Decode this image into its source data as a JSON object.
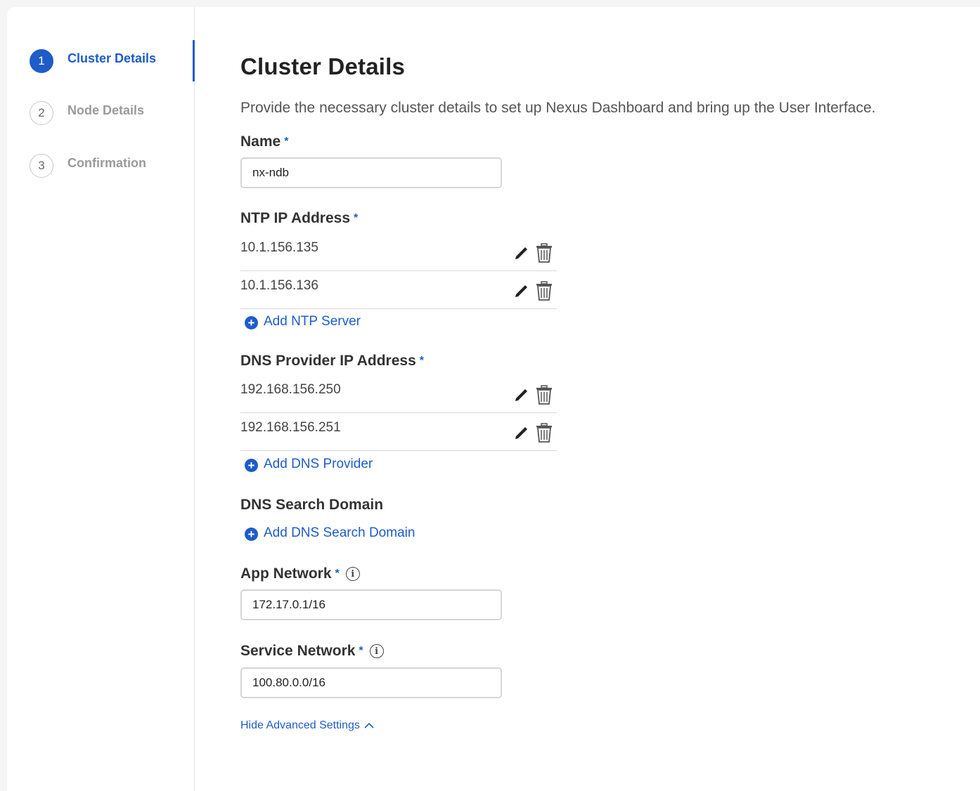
{
  "steps": [
    {
      "number": "1",
      "label": "Cluster Details",
      "active": true
    },
    {
      "number": "2",
      "label": "Node Details",
      "active": false
    },
    {
      "number": "3",
      "label": "Confirmation",
      "active": false
    }
  ],
  "main": {
    "title": "Cluster Details",
    "description": "Provide the necessary cluster details to set up Nexus Dashboard and bring up the User Interface.",
    "name": {
      "label": "Name",
      "required": "*",
      "value": "nx-ndb"
    },
    "ntp": {
      "label": "NTP IP Address",
      "required": "*",
      "items": [
        "10.1.156.135",
        "10.1.156.136"
      ],
      "add_label": "Add NTP Server"
    },
    "dns_provider": {
      "label": "DNS Provider IP Address",
      "required": "*",
      "items": [
        "192.168.156.250",
        "192.168.156.251"
      ],
      "add_label": "Add DNS Provider"
    },
    "dns_search": {
      "label": "DNS Search Domain",
      "add_label": "Add DNS Search Domain"
    },
    "app_network": {
      "label": "App Network",
      "required": "*",
      "value": "172.17.0.1/16"
    },
    "service_network": {
      "label": "Service Network",
      "required": "*",
      "value": "100.80.0.0/16"
    },
    "advanced_toggle": "Hide Advanced Settings"
  },
  "icons": {
    "edit": "pencil-icon",
    "delete": "trash-icon",
    "add": "plus-circle-icon",
    "info": "info-icon",
    "chevron": "chevron-up-icon"
  },
  "colors": {
    "accent": "#1e5cc9",
    "text": "#333333",
    "muted": "#9a9a9a"
  }
}
